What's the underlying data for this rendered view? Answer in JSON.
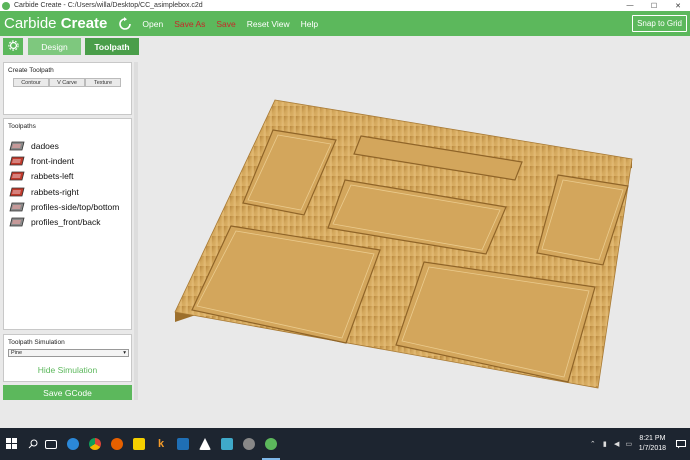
{
  "window": {
    "title": "Carbide Create - C:/Users/willa/Desktop/CC_asimplebox.c2d",
    "controls": [
      "—",
      "☐",
      "✕"
    ]
  },
  "header": {
    "brand_light": "Carbide",
    "brand_bold": "Create",
    "menu": {
      "open": "Open",
      "save_as": "Save As",
      "save": "Save",
      "reset_view": "Reset View",
      "help": "Help"
    },
    "snap": "Snap to Grid"
  },
  "tabs": {
    "design": "Design",
    "toolpath": "Toolpath"
  },
  "create_toolpath": {
    "heading": "Create Toolpath",
    "buttons": [
      "Contour",
      "V Carve",
      "Texture"
    ]
  },
  "toolpaths": {
    "heading": "Toolpaths",
    "items": [
      {
        "label": "dadoes",
        "icon": "toolpath-icon"
      },
      {
        "label": "front-indent",
        "icon": "toolpath-icon"
      },
      {
        "label": "rabbets-left",
        "icon": "toolpath-icon"
      },
      {
        "label": "rabbets-right",
        "icon": "toolpath-icon"
      },
      {
        "label": "profiles-side/top/bottom",
        "icon": "toolpath-icon"
      },
      {
        "label": "profiles_front/back",
        "icon": "toolpath-icon"
      }
    ]
  },
  "simulation": {
    "heading": "Toolpath Simulation",
    "material": "Pine",
    "hide": "Hide Simulation"
  },
  "save_gcode": "Save GCode",
  "taskbar": {
    "time": "8:21 PM",
    "date": "1/7/2018"
  },
  "colors": {
    "brand_green": "#5cb85c",
    "menu_red": "#c62828",
    "wood": "#d9aa5e"
  }
}
